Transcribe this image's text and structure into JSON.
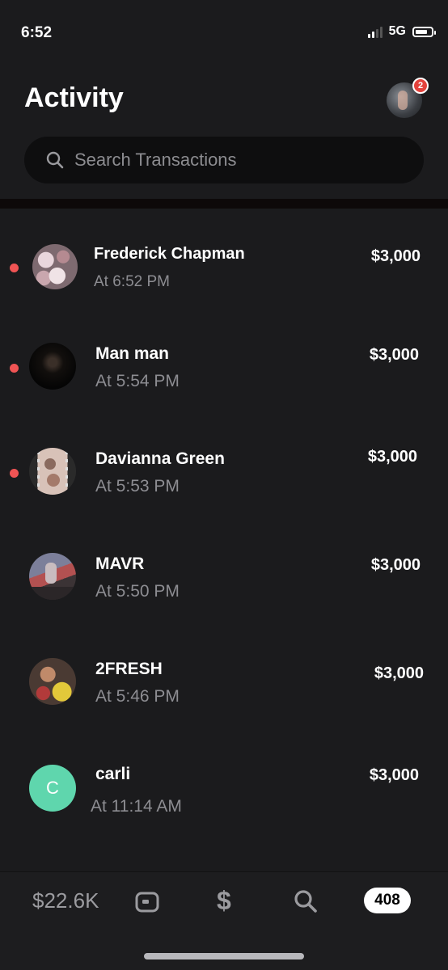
{
  "status_bar": {
    "time": "6:52",
    "network": "5G"
  },
  "header": {
    "title": "Activity",
    "notification_count": "2"
  },
  "search": {
    "placeholder": "Search Transactions",
    "icon": "search-icon"
  },
  "activity": [
    {
      "name": "Frederick Chapman",
      "time": "At 6:52 PM",
      "amount": "$3,000",
      "unread": true
    },
    {
      "name": "Man man",
      "time": "At 5:54 PM",
      "amount": "$3,000",
      "unread": true
    },
    {
      "name": "Davianna Green",
      "time": "At 5:53 PM",
      "amount": "$3,000",
      "unread": true
    },
    {
      "name": "MAVR",
      "time": "At 5:50 PM",
      "amount": "$3,000",
      "unread": false
    },
    {
      "name": "2FRESH",
      "time": "At 5:46 PM",
      "amount": "$3,000",
      "unread": false
    },
    {
      "name": "carli",
      "time": "At 11:14 AM",
      "amount": "$3,000",
      "unread": false,
      "initial": "C"
    }
  ],
  "tabbar": {
    "balance": "$22.6K",
    "pay_symbol": "$",
    "activity_count": "408",
    "icons": [
      "card-icon",
      "dollar-icon",
      "search-icon"
    ]
  },
  "colors": {
    "background": "#1b1b1d",
    "unread_dot": "#f05454",
    "badge": "#e3423c",
    "carli_avatar": "#5fd6ad",
    "muted_text": "#8d8d92"
  }
}
